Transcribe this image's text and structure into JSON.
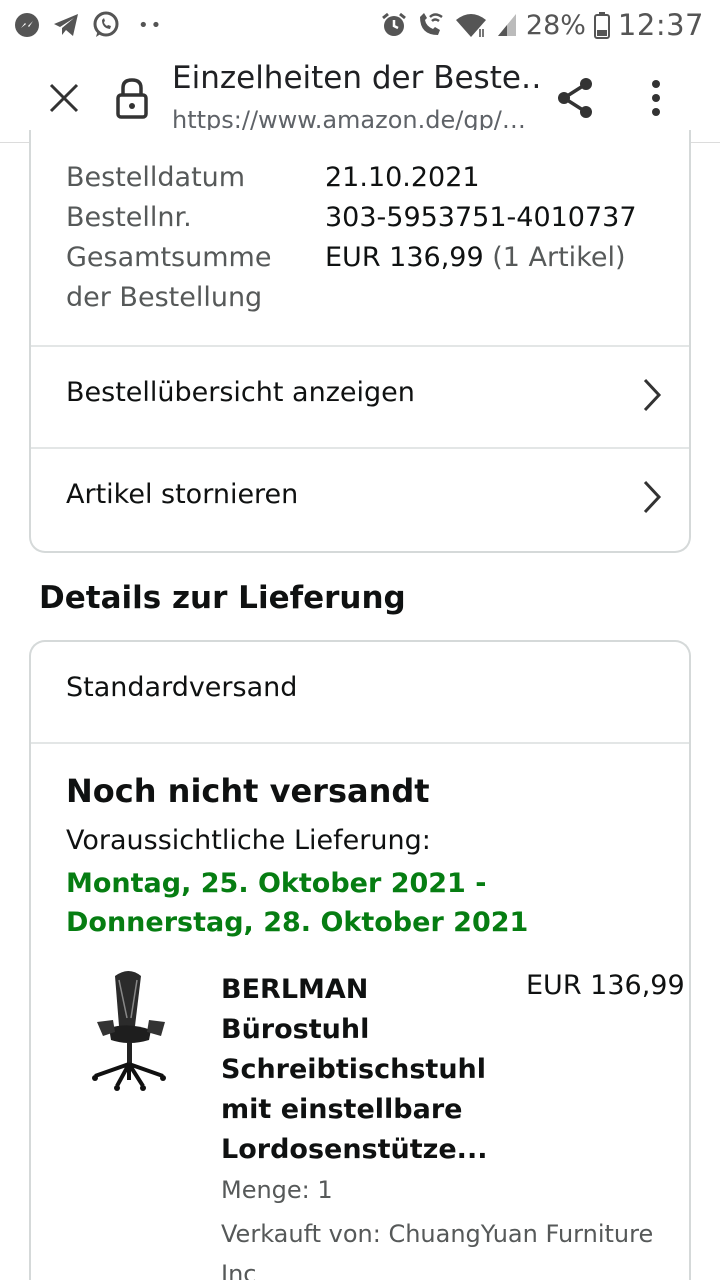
{
  "status_bar": {
    "time": "12:37",
    "battery": "28%",
    "left_icons": [
      "messenger-icon",
      "telegram-icon",
      "whatsapp-icon",
      "more-notifications-icon"
    ],
    "right_icons": [
      "alarm-icon",
      "wifi-call-icon",
      "wifi-icon",
      "signal-icon",
      "battery-icon"
    ]
  },
  "toolbar": {
    "title": "Einzelheiten der Beste…",
    "url": "https://www.amazon.de/gp/…"
  },
  "order": {
    "date_label": "Bestelldatum",
    "date_value": "21.10.2021",
    "number_label": "Bestellnr.",
    "number_value": "303-5953751-4010737",
    "total_label_line1": "Gesamtsumme",
    "total_label_line2": "der Bestellung",
    "total_value": "EUR 136,99",
    "total_items": "(1 Artikel)"
  },
  "actions": {
    "view_summary": "Bestellübersicht anzeigen",
    "cancel_items": "Artikel stornieren"
  },
  "delivery": {
    "section_title": "Details zur Lieferung",
    "shipping_method": "Standardversand",
    "status": "Noch nicht versandt",
    "estimated_label": "Voraussichtliche Lieferung:",
    "estimated_date": "Montag, 25. Oktober 2021 - Donnerstag, 28. Oktober 2021"
  },
  "product": {
    "title": "BERLMAN Bürostuhl Schreibtischstuhl mit einstellbare Lordosenstütze...",
    "price": "EUR 136,99",
    "quantity": "Menge: 1",
    "seller": "Verkauft von: ChuangYuan Furniture Inc"
  },
  "colors": {
    "delivery_green": "#067d12",
    "border": "#d5d9d9",
    "muted_text": "#565959"
  }
}
